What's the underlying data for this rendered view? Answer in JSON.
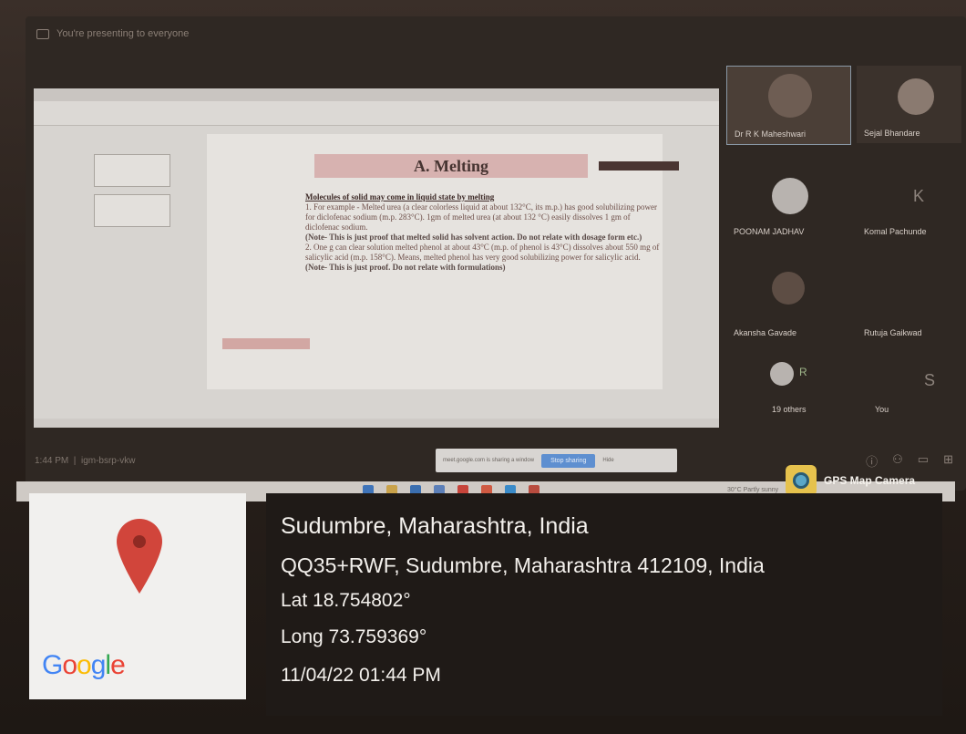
{
  "meet": {
    "presenting_text": "You're presenting to everyone",
    "bottom_time": "1:44 PM",
    "meeting_code": "igm-bsrp-vkw",
    "share_bar_text": "meet.google.com is sharing a window",
    "stop_sharing": "Stop sharing",
    "hide": "Hide"
  },
  "slide": {
    "title": "A. Melting",
    "heading": "Molecules of solid may come in liquid state by melting",
    "para1": "1. For example - Melted urea (a clear colorless liquid at about 132°C, its m.p.) has good solubilizing power for diclofenac sodium (m.p. 283°C). 1gm of melted urea (at about 132 °C) easily dissolves 1 gm of diclofenac sodium.",
    "note1": "(Note- This is just proof that melted solid has solvent action. Do not relate with dosage form etc.)",
    "para2": "2. One g can clear solution melted phenol at about 43°C (m.p. of phenol is 43°C) dissolves about 550 mg of salicylic acid (m.p. 158°C). Means, melted phenol has very good solubilizing power for salicylic acid.",
    "note2": "(Note- This is just proof. Do not relate with formulations)"
  },
  "participants": [
    {
      "name": "Dr R K Maheshwari"
    },
    {
      "name": "Sejal Bhandare"
    },
    {
      "name": "POONAM JADHAV"
    },
    {
      "name": "Komal Pachunde",
      "initial": "K"
    },
    {
      "name": "Akansha Gavade"
    },
    {
      "name": "Rutuja Gaikwad"
    },
    {
      "name": "19 others",
      "initial": "R"
    },
    {
      "name": "You",
      "initial": "S"
    }
  ],
  "taskbar": {
    "weather": "30°C Partly sunny"
  },
  "gps": {
    "brand": "GPS Map Camera",
    "map_brand": "Google",
    "location_title": "Sudumbre, Maharashtra, India",
    "address": "QQ35+RWF, Sudumbre, Maharashtra 412109, India",
    "lat": "Lat 18.754802°",
    "long": "Long 73.759369°",
    "datetime": "11/04/22 01:44 PM"
  },
  "colors": {
    "pin": "#d1453b",
    "info_bg": "#1f1a17",
    "stop_btn": "#5e8fd0"
  }
}
